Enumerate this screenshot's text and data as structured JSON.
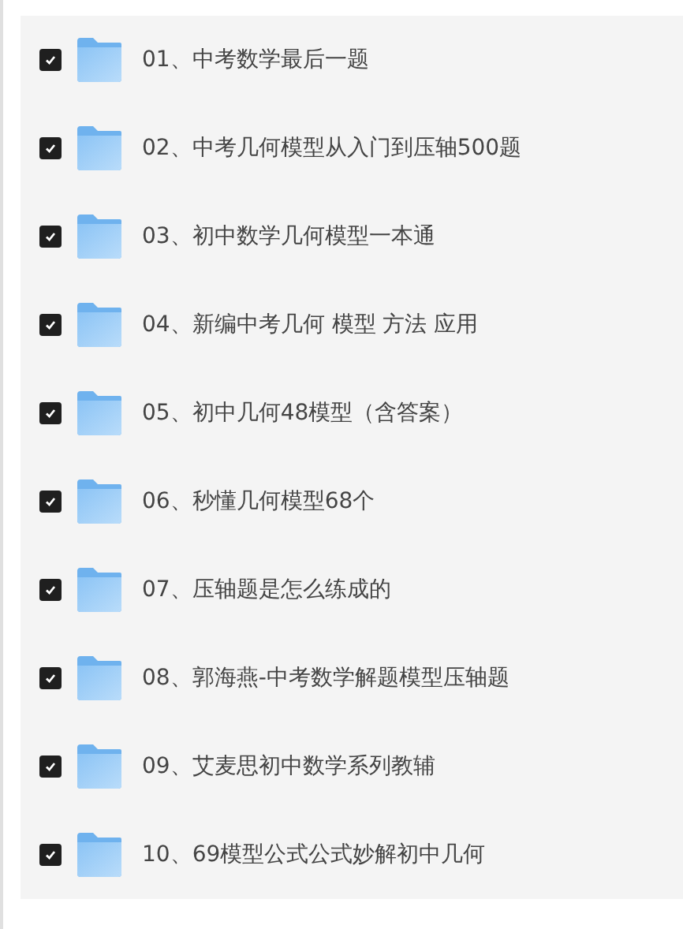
{
  "items": [
    {
      "label": "01、中考数学最后一题",
      "checked": true
    },
    {
      "label": "02、中考几何模型从入门到压轴500题",
      "checked": true
    },
    {
      "label": "03、初中数学几何模型一本通",
      "checked": true
    },
    {
      "label": "04、新编中考几何 模型 方法 应用",
      "checked": true
    },
    {
      "label": "05、初中几何48模型（含答案）",
      "checked": true
    },
    {
      "label": "06、秒懂几何模型68个",
      "checked": true
    },
    {
      "label": "07、压轴题是怎么练成的",
      "checked": true
    },
    {
      "label": "08、郭海燕-中考数学解题模型压轴题",
      "checked": true
    },
    {
      "label": "09、艾麦思初中数学系列教辅",
      "checked": true
    },
    {
      "label": "10、69模型公式公式妙解初中几何",
      "checked": true
    }
  ]
}
